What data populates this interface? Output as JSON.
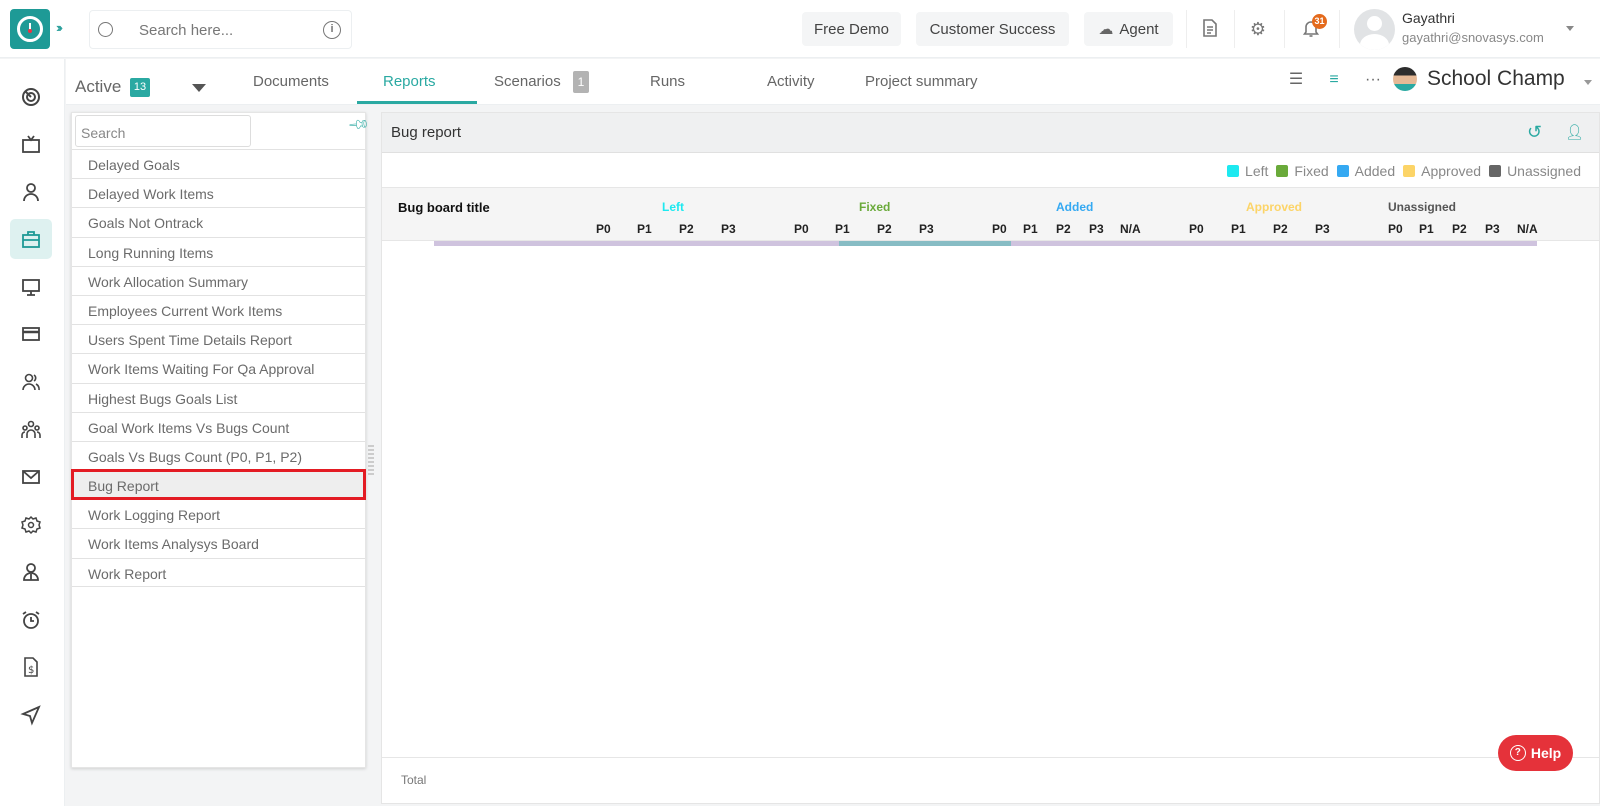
{
  "topbar": {
    "search_placeholder": "Search here...",
    "buttons": {
      "free_demo": "Free Demo",
      "customer_success": "Customer Success",
      "agent": "Agent"
    },
    "notification_count": "31",
    "user": {
      "name": "Gayathri",
      "email": "gayathri@snovasys.com"
    }
  },
  "rail": {
    "items": [
      "dashboard-icon",
      "tv-icon",
      "user-icon",
      "briefcase-icon",
      "monitor-icon",
      "card-icon",
      "users-icon",
      "team-icon",
      "mail-icon",
      "settings-icon",
      "profile-icon",
      "alarm-icon",
      "invoice-icon",
      "send-icon"
    ],
    "active": "briefcase-icon"
  },
  "subnav": {
    "active_label": "Active",
    "active_count": "13",
    "tabs": [
      {
        "label": "Documents"
      },
      {
        "label": "Reports",
        "selected": true
      },
      {
        "label": "Scenarios",
        "count": "1"
      },
      {
        "label": "Runs"
      },
      {
        "label": "Activity"
      },
      {
        "label": "Project summary"
      }
    ],
    "project_name": "School Champ"
  },
  "report_list": {
    "search_placeholder": "Search",
    "items": [
      "Delayed Goals",
      "Delayed Work Items",
      "Goals Not Ontrack",
      "Long Running Items",
      "Work Allocation Summary",
      "Employees Current Work Items",
      "Users Spent Time Details Report",
      "Work Items Waiting For Qa Approval",
      "Highest Bugs Goals List",
      "Goal Work Items Vs Bugs Count",
      "Goals Vs Bugs Count (P0, P1, P2)",
      "Bug Report",
      "Work Logging Report",
      "Work Items Analysys Board",
      "Work Report"
    ],
    "selected": "Bug Report"
  },
  "report": {
    "title": "Bug report",
    "legend": [
      {
        "label": "Left",
        "color": "#1de9f0"
      },
      {
        "label": "Fixed",
        "color": "#6aaa3a"
      },
      {
        "label": "Added",
        "color": "#35a9f2"
      },
      {
        "label": "Approved",
        "color": "#fcd467"
      },
      {
        "label": "Unassigned",
        "color": "#666666"
      }
    ],
    "board_title_header": "Bug board title",
    "groups": [
      {
        "label": "Left",
        "color": "#1de9f0",
        "cols": [
          "P0",
          "P1",
          "P2",
          "P3"
        ]
      },
      {
        "label": "Fixed",
        "color": "#6aaa3a",
        "cols": [
          "P0",
          "P1",
          "P2",
          "P3"
        ]
      },
      {
        "label": "Added",
        "color": "#35a9f2",
        "cols": [
          "P0",
          "P1",
          "P2",
          "P3",
          "N/A"
        ]
      },
      {
        "label": "Approved",
        "color": "#fcd467",
        "cols": [
          "P0",
          "P1",
          "P2",
          "P3"
        ]
      },
      {
        "label": "Unassigned",
        "color": "#555555",
        "cols": [
          "P0",
          "P1",
          "P2",
          "P3",
          "N/A"
        ]
      }
    ],
    "total_label": "Total"
  },
  "help_label": "Help"
}
